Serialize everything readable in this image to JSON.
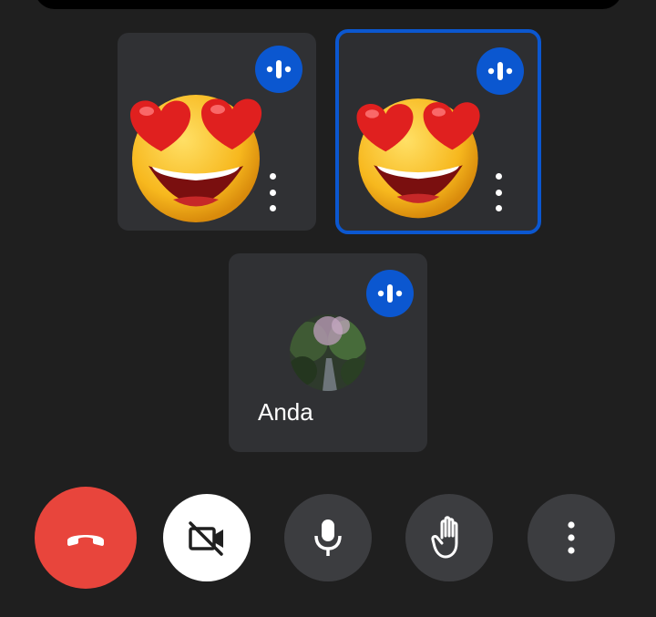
{
  "participants": [
    {
      "name": "",
      "status": "speaking",
      "active": false
    },
    {
      "name": "",
      "status": "speaking",
      "active": true
    },
    {
      "name": "Anda",
      "status": "speaking",
      "active": false
    }
  ],
  "controls": {
    "end_call": "end-call-icon",
    "camera": "camera-off-icon",
    "microphone": "microphone-icon",
    "raise_hand": "hand-icon",
    "more": "more-vert-icon"
  },
  "colors": {
    "background": "#1f1f1f",
    "tile": "#303134",
    "accent_blue": "#0b57d0",
    "end_call_red": "#e8453c",
    "control_gray": "#3c3d40"
  }
}
